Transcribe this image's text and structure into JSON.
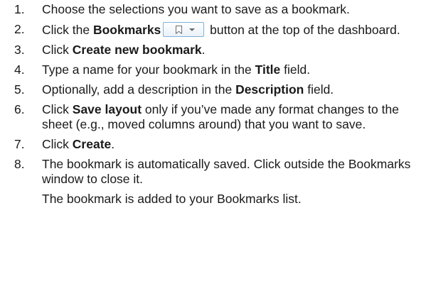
{
  "steps": [
    {
      "number": "1.",
      "text": "Choose the selections you want to save as a bookmark."
    },
    {
      "number": "2.",
      "before": "Click the ",
      "bold": "Bookmarks",
      "after": " button at the top of the dashboard.",
      "button_icon": "bookmark-icon"
    },
    {
      "number": "3.",
      "before": "Click ",
      "bold": "Create new bookmark",
      "after": "."
    },
    {
      "number": "4.",
      "before": "Type a name for your bookmark in the ",
      "bold": "Title",
      "after": " field."
    },
    {
      "number": "5.",
      "before": "Optionally, add a description in the ",
      "bold": "Description",
      "after": " field."
    },
    {
      "number": "6.",
      "before": "Click ",
      "bold": "Save layout",
      "after": " only if you’ve made any format changes to the sheet (e.g., moved columns around) that you want to save."
    },
    {
      "number": "7.",
      "before": "Click ",
      "bold": "Create",
      "after": "."
    },
    {
      "number": "8.",
      "text": "The bookmark is automatically saved. Click outside the Bookmarks window to close it."
    }
  ],
  "note": "The bookmark is added to your Bookmarks list.",
  "colors": {
    "text": "#1a1a1a",
    "button_border": "#7fb1d6"
  }
}
